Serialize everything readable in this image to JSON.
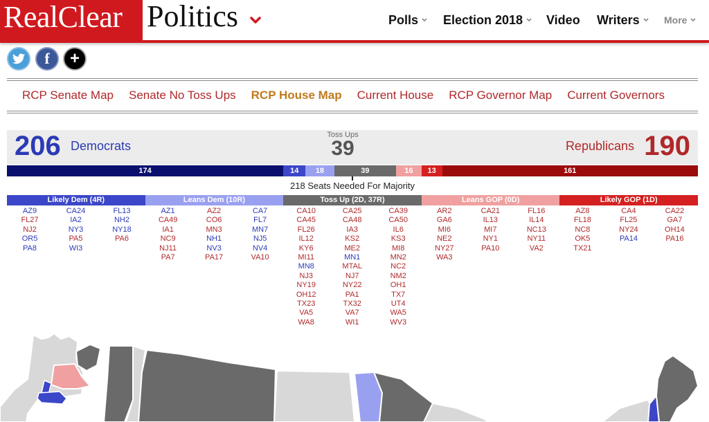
{
  "header": {
    "logo_left": "RealClear",
    "logo_right": "Politics",
    "nav": [
      {
        "label": "Polls",
        "has_menu": true
      },
      {
        "label": "Election 2018",
        "has_menu": true
      },
      {
        "label": "Video",
        "has_menu": false
      },
      {
        "label": "Writers",
        "has_menu": true
      },
      {
        "label": "More",
        "has_menu": true
      }
    ]
  },
  "social": [
    {
      "name": "twitter",
      "glyph": "🐦"
    },
    {
      "name": "facebook",
      "glyph": "f"
    },
    {
      "name": "share",
      "glyph": "+"
    }
  ],
  "map_tabs": [
    {
      "label": "RCP Senate Map",
      "active": false
    },
    {
      "label": "Senate No Toss Ups",
      "active": false
    },
    {
      "label": "RCP House Map",
      "active": true
    },
    {
      "label": "Current House",
      "active": false
    },
    {
      "label": "RCP Governor Map",
      "active": false
    },
    {
      "label": "Current Governors",
      "active": false
    }
  ],
  "summary": {
    "dem_total": "206",
    "dem_label": "Democrats",
    "rep_total": "190",
    "rep_label": "Republicans",
    "toss_label": "Toss Ups",
    "toss_total": "39",
    "majority_text": "218 Seats Needed For Majority"
  },
  "seat_bar": [
    {
      "label": "174",
      "value": 174,
      "color": "#0a0f6e"
    },
    {
      "label": "14",
      "value": 14,
      "color": "#3b46c8"
    },
    {
      "label": "18",
      "value": 18,
      "color": "#9aa0f0"
    },
    {
      "label": "39",
      "value": 39,
      "color": "#6a6a6a"
    },
    {
      "label": "16",
      "value": 16,
      "color": "#f0a0a0"
    },
    {
      "label": "13",
      "value": 13,
      "color": "#d42020"
    },
    {
      "label": "161",
      "value": 161,
      "color": "#9b0b0b"
    }
  ],
  "columns": [
    {
      "title": "Likely Dem (4R)",
      "color": "#3b46c8",
      "lists": [
        [
          [
            "AZ9",
            "d"
          ],
          [
            "FL27",
            "r"
          ],
          [
            "NJ2",
            "r"
          ],
          [
            "OR5",
            "d"
          ],
          [
            "PA8",
            "d"
          ]
        ],
        [
          [
            "CA24",
            "d"
          ],
          [
            "IA2",
            "d"
          ],
          [
            "NY3",
            "d"
          ],
          [
            "PA5",
            "r"
          ],
          [
            "WI3",
            "d"
          ]
        ],
        [
          [
            "FL13",
            "d"
          ],
          [
            "NH2",
            "d"
          ],
          [
            "NY18",
            "d"
          ],
          [
            "PA6",
            "r"
          ]
        ]
      ]
    },
    {
      "title": "Leans Dem (10R)",
      "color": "#9aa0f0",
      "lists": [
        [
          [
            "AZ1",
            "d"
          ],
          [
            "CA49",
            "r"
          ],
          [
            "IA1",
            "r"
          ],
          [
            "NC9",
            "r"
          ],
          [
            "NJ11",
            "r"
          ],
          [
            "PA7",
            "r"
          ]
        ],
        [
          [
            "AZ2",
            "r"
          ],
          [
            "CO6",
            "r"
          ],
          [
            "MN3",
            "r"
          ],
          [
            "NH1",
            "d"
          ],
          [
            "NV3",
            "d"
          ],
          [
            "PA17",
            "r"
          ]
        ],
        [
          [
            "CA7",
            "d"
          ],
          [
            "FL7",
            "d"
          ],
          [
            "MN7",
            "d"
          ],
          [
            "NJ5",
            "d"
          ],
          [
            "NV4",
            "d"
          ],
          [
            "VA10",
            "r"
          ]
        ]
      ]
    },
    {
      "title": "Toss Up (2D, 37R)",
      "color": "#6a6a6a",
      "lists": [
        [
          [
            "CA10",
            "r"
          ],
          [
            "CA45",
            "r"
          ],
          [
            "FL26",
            "r"
          ],
          [
            "IL12",
            "r"
          ],
          [
            "KY6",
            "r"
          ],
          [
            "MI11",
            "r"
          ],
          [
            "MN8",
            "d"
          ],
          [
            "NJ3",
            "r"
          ],
          [
            "NY19",
            "r"
          ],
          [
            "OH12",
            "r"
          ],
          [
            "TX23",
            "r"
          ],
          [
            "VA5",
            "r"
          ],
          [
            "WA8",
            "r"
          ]
        ],
        [
          [
            "CA25",
            "r"
          ],
          [
            "CA48",
            "r"
          ],
          [
            "IA3",
            "r"
          ],
          [
            "KS2",
            "r"
          ],
          [
            "ME2",
            "r"
          ],
          [
            "MN1",
            "d"
          ],
          [
            "MTAL",
            "r"
          ],
          [
            "NJ7",
            "r"
          ],
          [
            "NY22",
            "r"
          ],
          [
            "PA1",
            "r"
          ],
          [
            "TX32",
            "r"
          ],
          [
            "VA7",
            "r"
          ],
          [
            "WI1",
            "r"
          ]
        ],
        [
          [
            "CA39",
            "r"
          ],
          [
            "CA50",
            "r"
          ],
          [
            "IL6",
            "r"
          ],
          [
            "KS3",
            "r"
          ],
          [
            "MI8",
            "r"
          ],
          [
            "MN2",
            "r"
          ],
          [
            "NC2",
            "r"
          ],
          [
            "NM2",
            "r"
          ],
          [
            "OH1",
            "r"
          ],
          [
            "TX7",
            "r"
          ],
          [
            "UT4",
            "r"
          ],
          [
            "WA5",
            "r"
          ],
          [
            "WV3",
            "r"
          ]
        ]
      ]
    },
    {
      "title": "Leans GOP (0D)",
      "color": "#f0a0a0",
      "lists": [
        [
          [
            "AR2",
            "r"
          ],
          [
            "GA6",
            "r"
          ],
          [
            "MI6",
            "r"
          ],
          [
            "NE2",
            "r"
          ],
          [
            "NY27",
            "r"
          ],
          [
            "WA3",
            "r"
          ]
        ],
        [
          [
            "CA21",
            "r"
          ],
          [
            "IL13",
            "r"
          ],
          [
            "MI7",
            "r"
          ],
          [
            "NY1",
            "r"
          ],
          [
            "PA10",
            "r"
          ]
        ],
        [
          [
            "FL16",
            "r"
          ],
          [
            "IL14",
            "r"
          ],
          [
            "NC13",
            "r"
          ],
          [
            "NY11",
            "r"
          ],
          [
            "VA2",
            "r"
          ]
        ]
      ]
    },
    {
      "title": "Likely GOP (1D)",
      "color": "#d42020",
      "lists": [
        [
          [
            "AZ8",
            "r"
          ],
          [
            "FL18",
            "r"
          ],
          [
            "NC8",
            "r"
          ],
          [
            "OK5",
            "r"
          ],
          [
            "TX21",
            "r"
          ]
        ],
        [
          [
            "CA4",
            "r"
          ],
          [
            "FL25",
            "r"
          ],
          [
            "NY24",
            "r"
          ],
          [
            "PA14",
            "d"
          ]
        ],
        [
          [
            "CA22",
            "r"
          ],
          [
            "GA7",
            "r"
          ],
          [
            "OH14",
            "r"
          ],
          [
            "PA16",
            "r"
          ]
        ]
      ]
    }
  ],
  "map_colors": {
    "dem_likely": "#3b46c8",
    "dem_leans": "#9aa0f0",
    "tossup": "#6a6a6a",
    "gop_leans": "#f0a0a0",
    "safe": "#d8d8d8"
  }
}
